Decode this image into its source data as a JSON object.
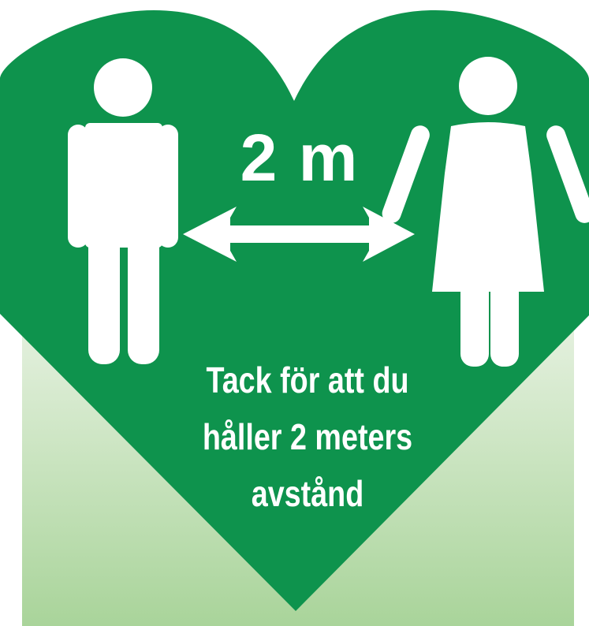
{
  "sign": {
    "distance_label": "2 m",
    "message_lines": [
      "Tack för att du",
      "håller 2 meters",
      "avstånd"
    ]
  },
  "icons": {
    "man": "man-figure-icon",
    "woman": "woman-figure-icon",
    "arrow": "double-arrow-icon"
  },
  "colors": {
    "heart_green": "#0e934d",
    "gradient_top": "#e3f0dd",
    "gradient_bottom": "#a9d49a",
    "foreground": "#ffffff"
  }
}
